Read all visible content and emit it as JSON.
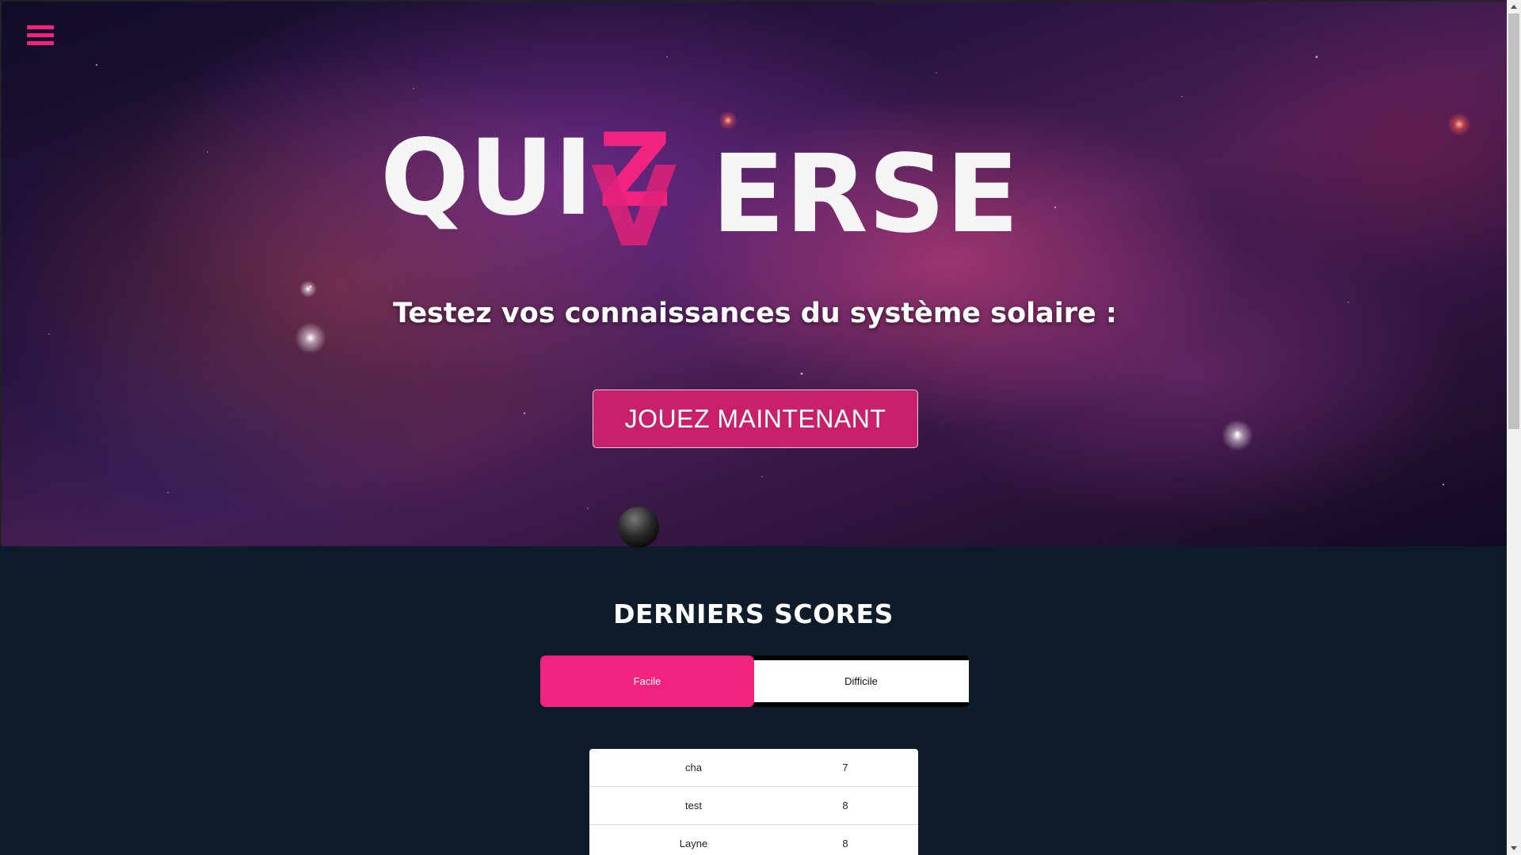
{
  "menu": {
    "icon": "hamburger-menu-icon",
    "color": "#f0237f"
  },
  "logo": {
    "part1": "QUI",
    "part2": "Z",
    "part3": "V",
    "part4": "ERSE",
    "accent": "#f0237f"
  },
  "hero": {
    "subtitle": "Testez vos connaissances du système solaire :",
    "play_label": "JOUEZ MAINTENANT"
  },
  "scores": {
    "title": "DERNIERS SCORES",
    "tabs": [
      {
        "label": "Facile",
        "active": true
      },
      {
        "label": "Difficile",
        "active": false
      }
    ],
    "rows": [
      {
        "name": "cha",
        "score": "7"
      },
      {
        "name": "test",
        "score": "8"
      },
      {
        "name": "Layne",
        "score": "8"
      }
    ]
  },
  "colors": {
    "accent": "#f0237f",
    "button": "#c8206a",
    "section_bg": "#0d1b2a"
  }
}
